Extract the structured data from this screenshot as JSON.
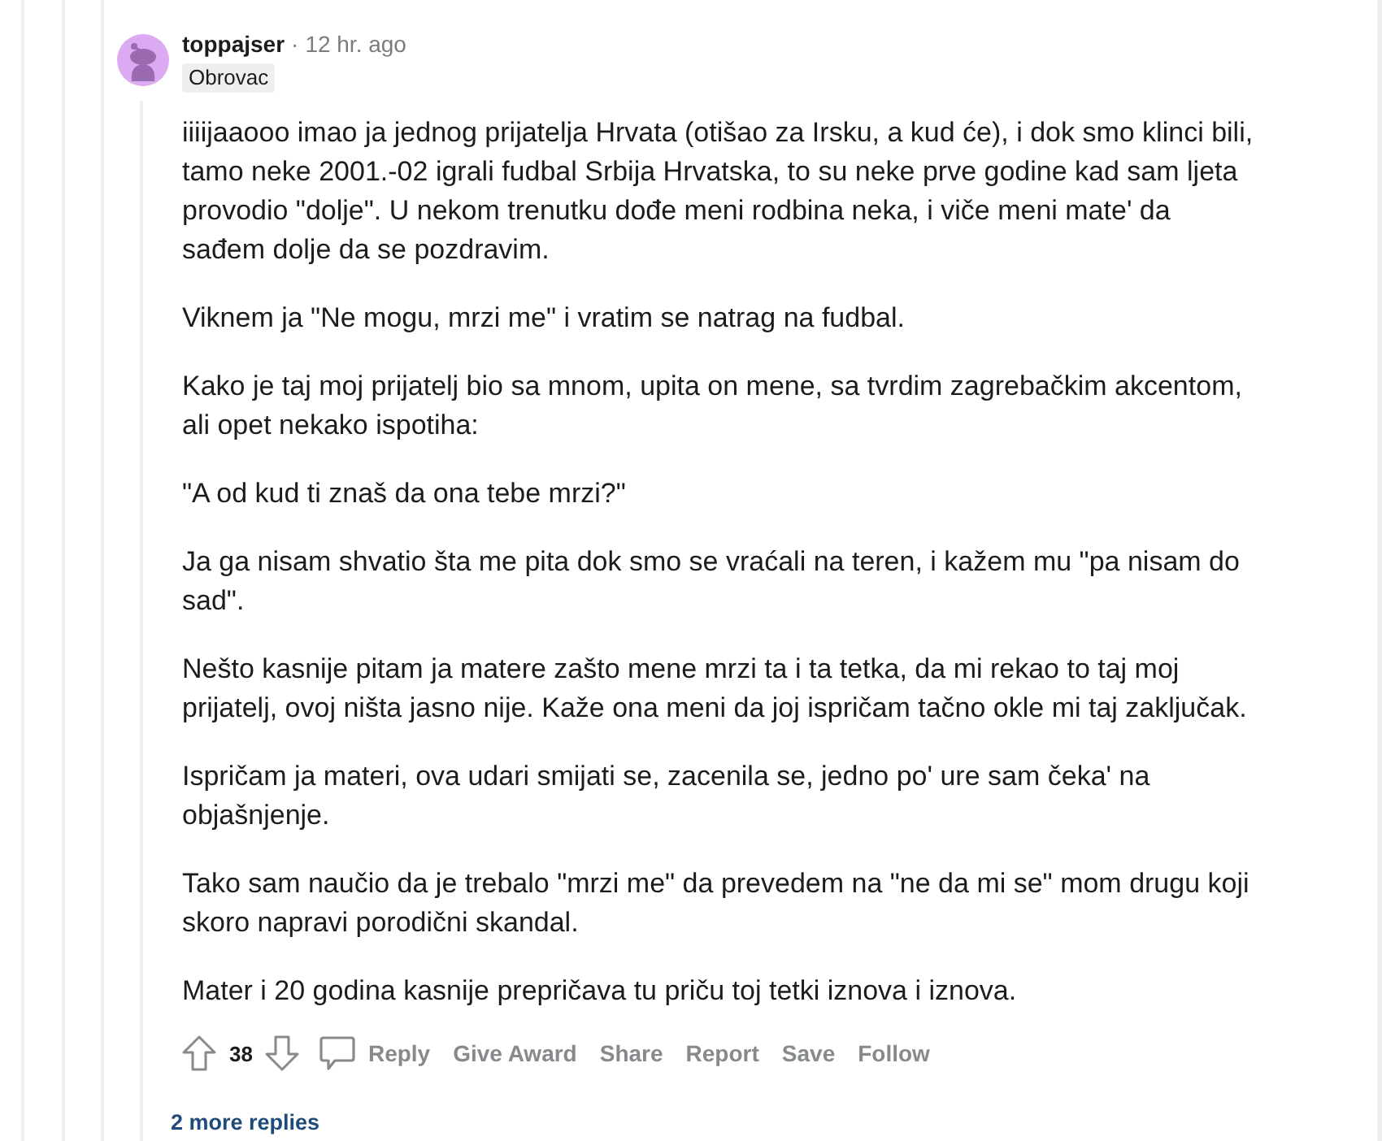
{
  "comment": {
    "author": "toppajser",
    "separator": "·",
    "age": "12 hr. ago",
    "flair": "Obrovac",
    "paragraphs": [
      "iiiijaaooo imao ja jednog prijatelja Hrvata (otišao za Irsku, a kud će), i dok smo klinci bili, tamo neke 2001.-02 igrali fudbal Srbija Hrvatska, to su neke prve godine kad sam ljeta provodio \"dolje\". U nekom trenutku dođe meni rodbina neka, i viče meni mate' da sađem dolje da se pozdravim.",
      "Viknem ja \"Ne mogu, mrzi me\" i vratim se natrag na fudbal.",
      "Kako je taj moj prijatelj bio sa mnom, upita on mene, sa tvrdim zagrebačkim akcentom, ali opet nekako ispotiha:",
      "\"A od kud ti znaš da ona tebe mrzi?\"",
      "Ja ga nisam shvatio šta me pita dok smo se vraćali na teren, i kažem mu \"pa nisam do sad\".",
      "Nešto kasnije pitam ja matere zašto mene mrzi ta i ta tetka, da mi rekao to taj moj prijatelj, ovoj ništa jasno nije. Kaže ona meni da joj ispričam tačno okle mi taj zaključak.",
      "Ispričam ja materi, ova udari smijati se, zacenila se, jedno po' ure sam čeka' na objašnjenje.",
      "Tako sam naučio da je trebalo \"mrzi me\" da prevedem na \"ne da mi se\" mom drugu koji skoro napravi porodični skandal.",
      "Mater i 20 godina kasnije prepričava tu priču toj tetki iznova i iznova."
    ],
    "score": "38",
    "reply": "Reply",
    "actions": [
      "Give Award",
      "Share",
      "Report",
      "Save",
      "Follow"
    ]
  },
  "more_replies": "2 more replies"
}
